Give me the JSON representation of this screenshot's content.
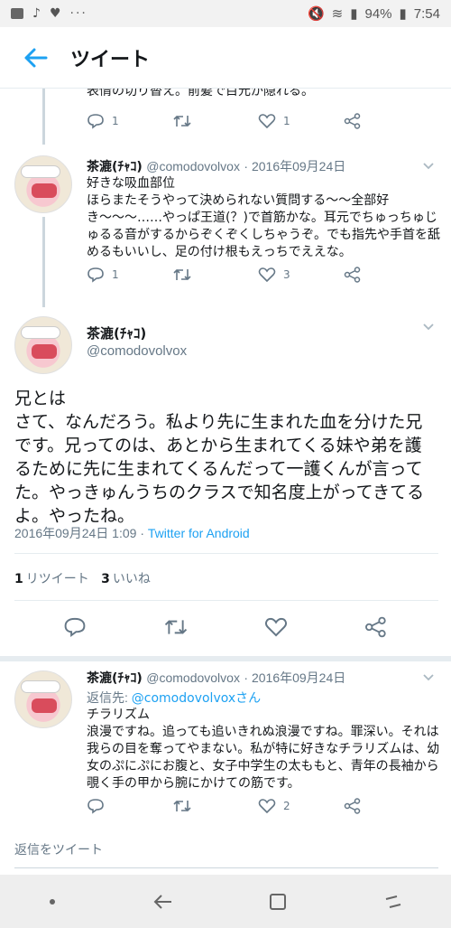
{
  "status": {
    "battery": "94%",
    "time": "7:54"
  },
  "header": {
    "title": "ツイート"
  },
  "top_tweet": {
    "text": "表情の切り替え。前髪で目元が隠れる。",
    "replies": "1",
    "likes": "1"
  },
  "tweet2": {
    "name": "茶漉(ﾁｬｺ)",
    "handle": "@comodovolvox",
    "date": "· 2016年09月24日",
    "text": "好きな吸血部位\nほらまたそうやって決められない質問する〜〜全部好き〜〜〜……やっぱ王道(？)で首筋かな。耳元でちゅっちゅじゅるる音がするからぞくぞくしちゃうぞ。でも指先や手首を舐めるもいいし、足の付け根もえっちでええな。",
    "replies": "1",
    "likes": "3"
  },
  "focus": {
    "name": "茶漉(ﾁｬｺ)",
    "handle": "@comodovolvox",
    "text": "兄とは\nさて、なんだろう。私より先に生まれた血を分けた兄です。兄ってのは、あとから生まれてくる妹や弟を護るために先に生まれてくるんだって一護くんが言ってた。やっきゅんうちのクラスで知名度上がってきてるよ。やったね。",
    "meta_date": "2016年09月24日 1:09 · ",
    "meta_source": "Twitter for Android",
    "retweets_num": "1",
    "retweets_label": "リツイート",
    "likes_num": "3",
    "likes_label": "いいね"
  },
  "tweet4": {
    "name": "茶漉(ﾁｬｺ)",
    "handle": "@comodovolvox",
    "date": "· 2016年09月24日",
    "reply_label": "返信先: ",
    "reply_target": "@comodovolvoxさん",
    "text": "チラリズム\n浪漫ですね。追っても追いきれぬ浪漫ですね。罪深い。それは我らの目を奪ってやまない。私が特に好きなチラリズムは、幼女のぷにぷにお腹と、女子中学生の太ももと、青年の長袖から覗く手の甲から腕にかけての筋です。",
    "likes": "2"
  },
  "compose": {
    "placeholder": "返信をツイート"
  }
}
